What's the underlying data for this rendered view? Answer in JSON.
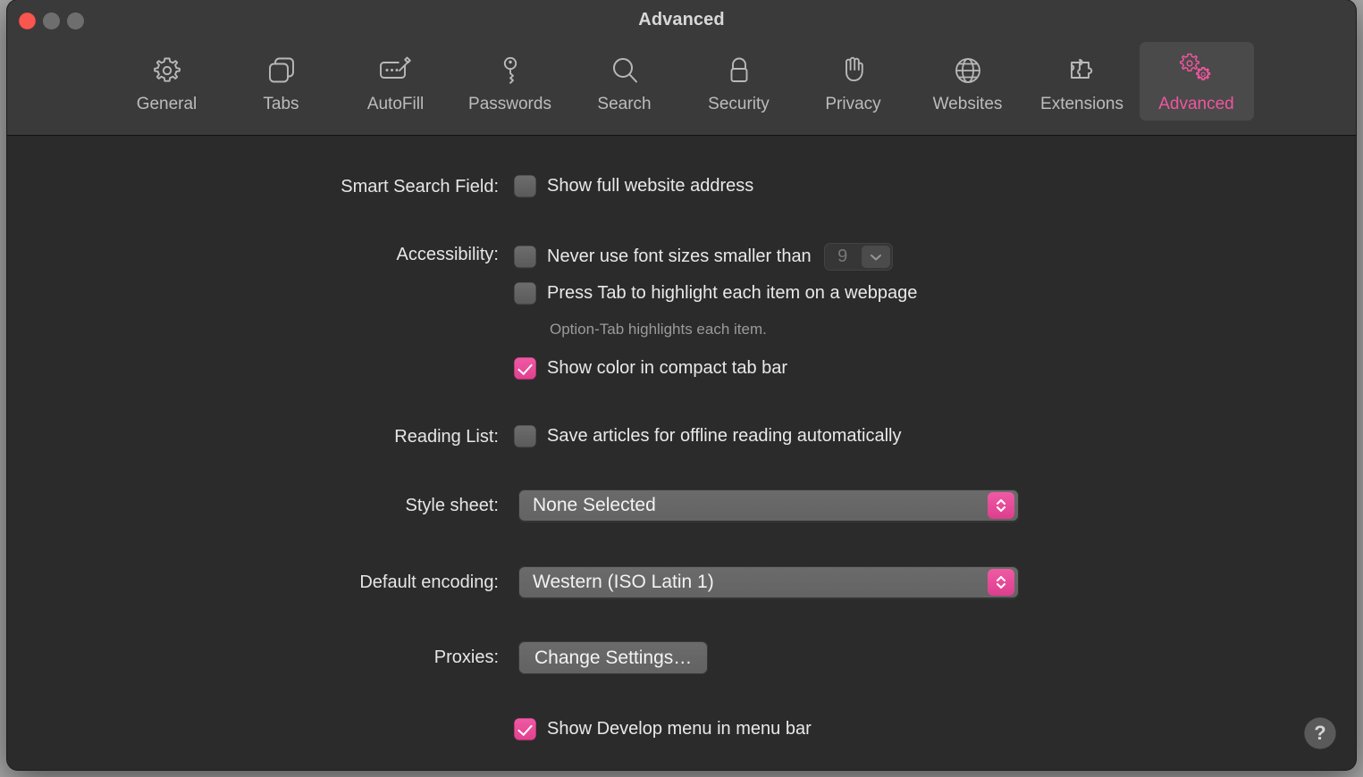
{
  "window": {
    "title": "Advanced",
    "traffic_lights": [
      {
        "name": "close",
        "color": "#f9564f"
      },
      {
        "name": "minimize",
        "color": "#6e6e6e"
      },
      {
        "name": "zoom",
        "color": "#6e6e6e"
      }
    ]
  },
  "accent_color": "#f0559f",
  "toolbar": {
    "tabs": [
      {
        "label": "General",
        "icon": "gear-icon",
        "active": false
      },
      {
        "label": "Tabs",
        "icon": "tabs-icon",
        "active": false
      },
      {
        "label": "AutoFill",
        "icon": "autofill-icon",
        "active": false
      },
      {
        "label": "Passwords",
        "icon": "key-icon",
        "active": false
      },
      {
        "label": "Search",
        "icon": "search-icon",
        "active": false
      },
      {
        "label": "Security",
        "icon": "lock-icon",
        "active": false
      },
      {
        "label": "Privacy",
        "icon": "hand-icon",
        "active": false
      },
      {
        "label": "Websites",
        "icon": "globe-icon",
        "active": false
      },
      {
        "label": "Extensions",
        "icon": "puzzle-icon",
        "active": false
      },
      {
        "label": "Advanced",
        "icon": "gears-icon",
        "active": true
      }
    ]
  },
  "settings": {
    "smart_search": {
      "label": "Smart Search Field:",
      "show_full_address": {
        "text": "Show full website address",
        "checked": false
      }
    },
    "accessibility": {
      "label": "Accessibility:",
      "min_font_size": {
        "text": "Never use font sizes smaller than",
        "checked": false,
        "value": "9",
        "disabled": true
      },
      "press_tab": {
        "text": "Press Tab to highlight each item on a webpage",
        "checked": false,
        "hint": "Option-Tab highlights each item."
      },
      "compact_tab_color": {
        "text": "Show color in compact tab bar",
        "checked": true
      }
    },
    "reading_list": {
      "label": "Reading List:",
      "save_offline": {
        "text": "Save articles for offline reading automatically",
        "checked": false
      }
    },
    "style_sheet": {
      "label": "Style sheet:",
      "value": "None Selected"
    },
    "default_encoding": {
      "label": "Default encoding:",
      "value": "Western (ISO Latin 1)"
    },
    "proxies": {
      "label": "Proxies:",
      "button": "Change Settings…"
    },
    "develop_menu": {
      "text": "Show Develop menu in menu bar",
      "checked": true
    }
  },
  "help_button": {
    "glyph": "?"
  }
}
